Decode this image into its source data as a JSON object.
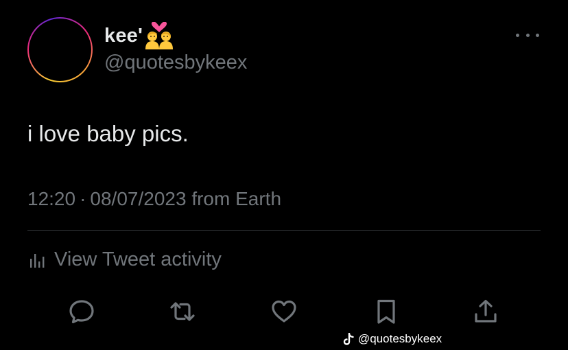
{
  "author": {
    "display_name": "kee'",
    "name_emoji": "couple-with-heart-emoji",
    "handle": "@quotesbykeex"
  },
  "tweet": {
    "text": "i love baby pics."
  },
  "meta": {
    "time": "12:20",
    "separator": "·",
    "date": "08/07/2023",
    "source": "from Earth"
  },
  "activity": {
    "label": "View Tweet activity",
    "icon": "bar-chart-icon"
  },
  "actions": [
    {
      "name": "reply",
      "icon": "speech-bubble-icon"
    },
    {
      "name": "retweet",
      "icon": "retweet-arrows-icon"
    },
    {
      "name": "like",
      "icon": "heart-icon"
    },
    {
      "name": "bookmark",
      "icon": "bookmark-icon"
    },
    {
      "name": "share",
      "icon": "share-upload-icon"
    }
  ],
  "watermark": {
    "icon": "tiktok-logo-icon",
    "text": "@quotesbykeex"
  },
  "colors": {
    "background": "#000000",
    "primary_text": "#e7e9ea",
    "secondary_text": "#71767b",
    "divider": "#2f3336"
  }
}
